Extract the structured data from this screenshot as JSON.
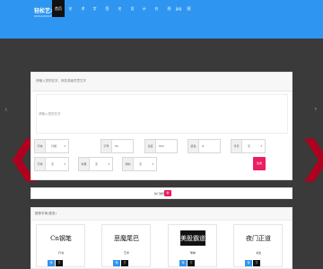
{
  "topbar": {
    "logo_main": "轻松艺术签",
    "logo_sub": "QINGSONGYISHU",
    "nav": [
      {
        "label": "首页",
        "active": true
      },
      {
        "label": "艺"
      },
      {
        "label": "术"
      },
      {
        "label": "字"
      },
      {
        "label": "签"
      },
      {
        "label": "名"
      },
      {
        "label": "设"
      },
      {
        "label": "计"
      },
      {
        "label": "在"
      },
      {
        "label": "线"
      },
      {
        "label": "jpg"
      },
      {
        "label": "图"
      }
    ]
  },
  "side": {
    "left": "上",
    "right": "下",
    "left_arrow": "❮",
    "right_arrow": "❯"
  },
  "top_panel": {
    "title": "请输入您的名字、网名或者任意文字",
    "placeholder": "请输入您的名字"
  },
  "fields": {
    "row1": [
      {
        "label": "字体",
        "value": "行楷",
        "caret": "▾"
      },
      {
        "label": "字号",
        "value": "80"
      },
      {
        "label": "宽度",
        "value": "800"
      },
      {
        "label": "颜色",
        "value": "#"
      },
      {
        "label": "背景",
        "value": "无",
        "caret": "▾"
      }
    ],
    "row2": [
      {
        "label": "字体",
        "value": "无",
        "caret": "▾"
      },
      {
        "label": "效果",
        "value": "无",
        "caret": "▾"
      },
      {
        "label": "倾斜",
        "value": "无",
        "caret": "▾"
      }
    ],
    "submit": "生成"
  },
  "strip": {
    "text": "热门推荐",
    "badge": "新"
  },
  "bottom_panel": {
    "title": "推荐字体(更多)",
    "cards": [
      {
        "image_text": "Cn钢笔",
        "name": "行书",
        "btn_a": "预",
        "btn_b": "下"
      },
      {
        "image_text": "恶魔尾巴",
        "name": "艺术",
        "btn_a": "预",
        "btn_b": "下"
      },
      {
        "image_text": "美股霸道",
        "name": "繁体",
        "btn_a": "预",
        "btn_b": "下"
      },
      {
        "image_text": "夜门正道",
        "name": "书法",
        "btn_a": "预",
        "btn_b": "下"
      }
    ]
  }
}
